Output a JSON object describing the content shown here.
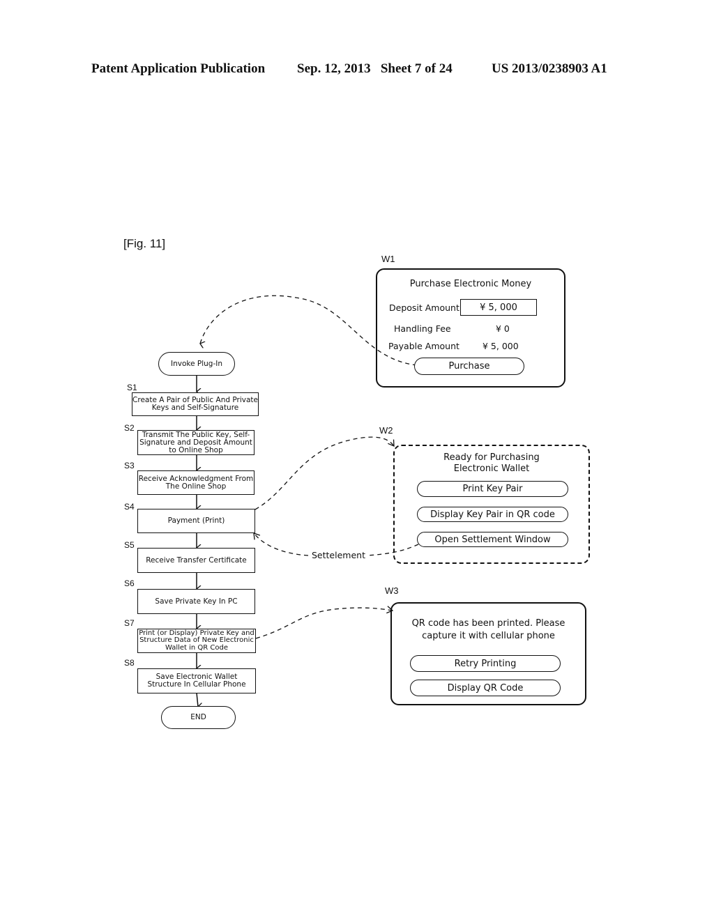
{
  "header": {
    "publication": "Patent Application Publication",
    "date_sheet": "Sep. 12, 2013   Sheet 7 of 24",
    "number": "US 2013/0238903 A1"
  },
  "figure_label": "[Fig. 11]",
  "flowchart": {
    "start": "Invoke Plug-In",
    "end": "END",
    "steps": [
      {
        "id": "S1",
        "text": "Create A Pair of Public And Private Keys and Self-Signature"
      },
      {
        "id": "S2",
        "text": "Transmit The Public Key, Self-Signature and Deposit Amount to Online Shop"
      },
      {
        "id": "S3",
        "text": "Receive Acknowledgment From The Online Shop"
      },
      {
        "id": "S4",
        "text": "Payment (Print)"
      },
      {
        "id": "S5",
        "text": "Receive Transfer Certificate"
      },
      {
        "id": "S6",
        "text": "Save Private Key In PC"
      },
      {
        "id": "S7",
        "text": "Print (or Display) Private Key and Structure Data of New Electronic Wallet in QR Code"
      },
      {
        "id": "S8",
        "text": "Save Electronic Wallet Structure In Cellular Phone"
      }
    ],
    "settlement_label": "Settelement"
  },
  "windows": {
    "w1": {
      "id": "W1",
      "title": "Purchase Electronic Money",
      "deposit_label": "Deposit Amount",
      "deposit_value": "¥ 5, 000",
      "fee_label": "Handling Fee",
      "fee_value": "¥ 0",
      "payable_label": "Payable Amount",
      "payable_value": "¥ 5, 000",
      "purchase_button": "Purchase"
    },
    "w2": {
      "id": "W2",
      "title_line1": "Ready for Purchasing",
      "title_line2": "Electronic Wallet",
      "buttons": [
        "Print Key Pair",
        "Display Key Pair in QR code",
        "Open Settlement Window"
      ]
    },
    "w3": {
      "id": "W3",
      "message_line1": "QR code has been printed. Please",
      "message_line2": "capture it with cellular phone",
      "buttons": [
        "Retry Printing",
        "Display QR Code"
      ]
    }
  }
}
